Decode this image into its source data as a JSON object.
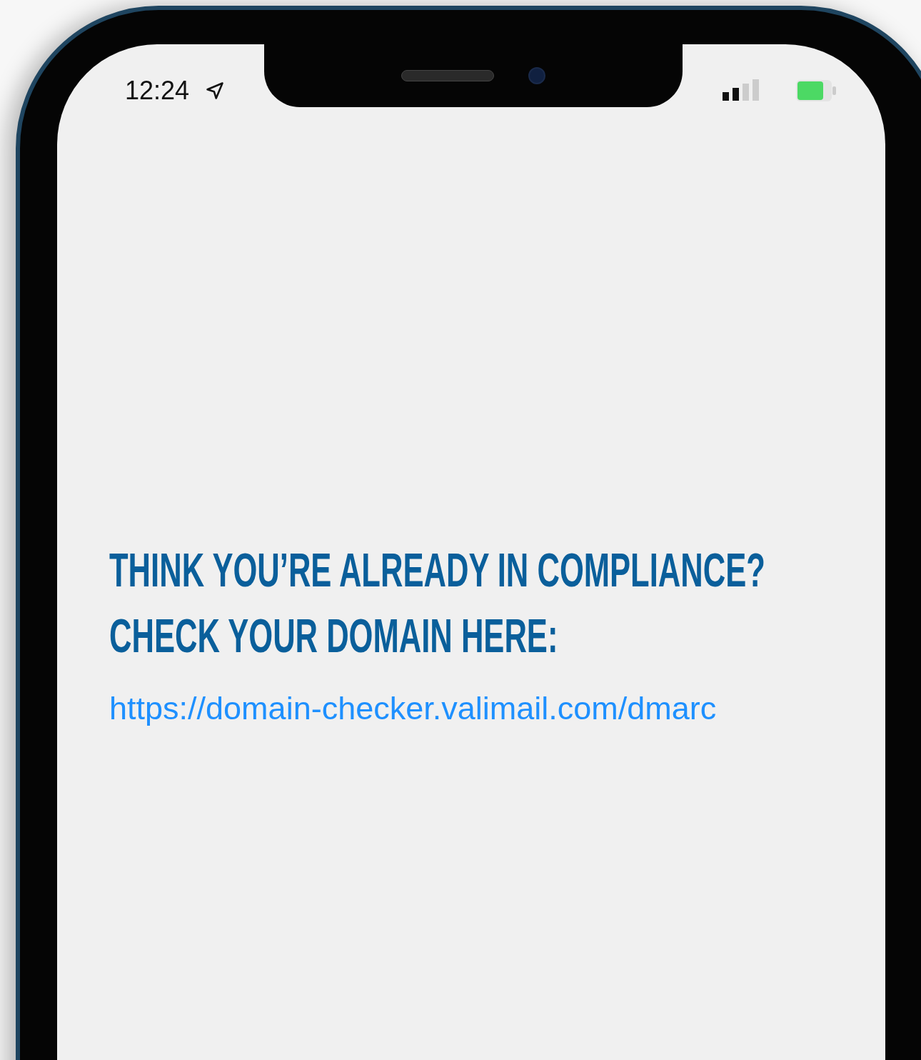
{
  "status_bar": {
    "time": "12:24"
  },
  "content": {
    "heading_lines": [
      "THINK YOU’RE ALREADY IN COMPLIANCE?",
      "CHECK YOUR DOMAIN HERE:"
    ],
    "link": "https://domain-checker.valimail.com/dmarc"
  }
}
